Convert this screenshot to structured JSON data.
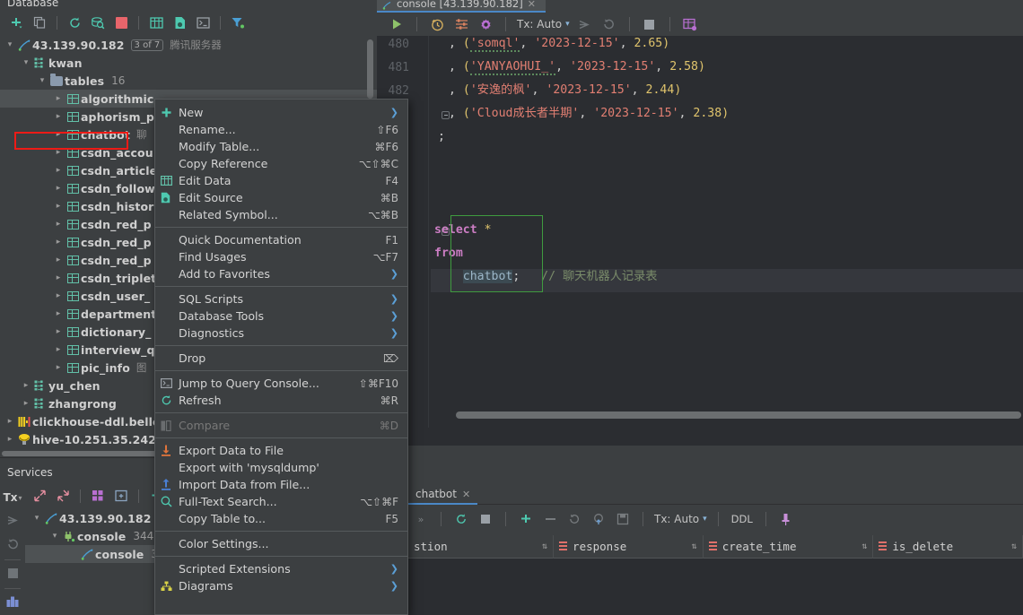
{
  "database_panel": {
    "title": "Database",
    "toolbar": [
      {
        "name": "new-button",
        "icon": "plus-icon"
      },
      {
        "name": "copy-button",
        "icon": "copy-icon"
      },
      {
        "name": "refresh-button",
        "icon": "refresh-icon"
      },
      {
        "name": "search-db-button",
        "icon": "db-search-icon"
      },
      {
        "name": "stop-button",
        "icon": "stop-square-icon"
      },
      {
        "name": "table-view-button",
        "icon": "grid-icon"
      },
      {
        "name": "source-button",
        "icon": "source-file-icon"
      },
      {
        "name": "console-button",
        "icon": "terminal-icon"
      },
      {
        "name": "filter-button",
        "icon": "funnel-icon"
      }
    ],
    "tree": [
      {
        "label": "43.139.90.182",
        "badge": "3 of 7",
        "note": "腾讯服务器",
        "icon": "mysql-icon",
        "state": "open",
        "indent": 0
      },
      {
        "label": "kwan",
        "icon": "schema-icon",
        "state": "open",
        "indent": 1
      },
      {
        "label": "tables",
        "count": "16",
        "icon": "folder-icon",
        "state": "open",
        "indent": 2
      },
      {
        "label": "algorithmic",
        "icon": "table-icon",
        "state": "closed",
        "indent": 3,
        "selected": true
      },
      {
        "label": "aphorism_p",
        "icon": "table-icon",
        "state": "closed",
        "indent": 3
      },
      {
        "label": "chatbot",
        "note": "聊",
        "icon": "table-icon",
        "state": "closed",
        "indent": 3
      },
      {
        "label": "csdn_accou",
        "icon": "table-icon",
        "state": "closed",
        "indent": 3
      },
      {
        "label": "csdn_article",
        "icon": "table-icon",
        "state": "closed",
        "indent": 3
      },
      {
        "label": "csdn_follow",
        "icon": "table-icon",
        "state": "closed",
        "indent": 3
      },
      {
        "label": "csdn_histor",
        "icon": "table-icon",
        "state": "closed",
        "indent": 3
      },
      {
        "label": "csdn_red_p",
        "icon": "table-icon",
        "state": "closed",
        "indent": 3
      },
      {
        "label": "csdn_red_p",
        "icon": "table-icon",
        "state": "closed",
        "indent": 3
      },
      {
        "label": "csdn_red_p",
        "icon": "table-icon",
        "state": "closed",
        "indent": 3
      },
      {
        "label": "csdn_triplet",
        "icon": "table-icon",
        "state": "closed",
        "indent": 3
      },
      {
        "label": "csdn_user_",
        "icon": "table-icon",
        "state": "closed",
        "indent": 3
      },
      {
        "label": "department",
        "icon": "table-icon",
        "state": "closed",
        "indent": 3
      },
      {
        "label": "dictionary_",
        "icon": "table-icon",
        "state": "closed",
        "indent": 3
      },
      {
        "label": "interview_q",
        "icon": "table-icon",
        "state": "closed",
        "indent": 3
      },
      {
        "label": "pic_info",
        "note": "图",
        "icon": "table-icon",
        "state": "closed",
        "indent": 3
      },
      {
        "label": "yu_chen",
        "icon": "schema-icon",
        "state": "closed",
        "indent": 1
      },
      {
        "label": "zhangrong",
        "icon": "schema-icon",
        "state": "closed",
        "indent": 1
      },
      {
        "label": "clickhouse-ddl.belle",
        "icon": "clickhouse-icon",
        "state": "closed",
        "indent": 0
      },
      {
        "label": "hive-10.251.35.242",
        "icon": "hive-icon",
        "state": "closed",
        "indent": 0
      }
    ]
  },
  "context_menu": {
    "groups": [
      [
        {
          "label": "New",
          "icon": "plus-icon",
          "submenu": true
        },
        {
          "label": "Rename...",
          "shortcut": "⇧F6"
        },
        {
          "label": "Modify Table...",
          "shortcut": "⌘F6",
          "highlighted": true
        },
        {
          "label": "Copy Reference",
          "shortcut": "⌥⇧⌘C"
        },
        {
          "label": "Edit Data",
          "shortcut": "F4",
          "icon": "grid-icon"
        },
        {
          "label": "Edit Source",
          "shortcut": "⌘B",
          "icon": "source-file-icon"
        },
        {
          "label": "Related Symbol...",
          "shortcut": "⌥⌘B"
        }
      ],
      [
        {
          "label": "Quick Documentation",
          "shortcut": "F1"
        },
        {
          "label": "Find Usages",
          "shortcut": "⌥F7"
        },
        {
          "label": "Add to Favorites",
          "submenu": true
        }
      ],
      [
        {
          "label": "SQL Scripts",
          "submenu": true
        },
        {
          "label": "Database Tools",
          "submenu": true
        },
        {
          "label": "Diagnostics",
          "submenu": true
        }
      ],
      [
        {
          "label": "Drop",
          "shortcut": "⌦"
        }
      ],
      [
        {
          "label": "Jump to Query Console...",
          "shortcut": "⇧⌘F10",
          "icon": "terminal-icon"
        },
        {
          "label": "Refresh",
          "shortcut": "⌘R",
          "icon": "refresh-icon"
        }
      ],
      [
        {
          "label": "Compare",
          "shortcut": "⌘D",
          "icon": "compare-icon",
          "disabled": true
        }
      ],
      [
        {
          "label": "Export Data to File",
          "icon": "export-icon"
        },
        {
          "label": "Export with 'mysqldump'"
        },
        {
          "label": "Import Data from File...",
          "icon": "import-icon"
        },
        {
          "label": "Full-Text Search...",
          "shortcut": "⌥⇧⌘F",
          "icon": "search-icon"
        },
        {
          "label": "Copy Table to...",
          "shortcut": "F5"
        }
      ],
      [
        {
          "label": "Color Settings..."
        }
      ],
      [
        {
          "label": "Scripted Extensions",
          "submenu": true
        },
        {
          "label": "Diagrams",
          "submenu": true,
          "icon": "diagram-icon"
        }
      ]
    ],
    "highlight_color": "#ee1b16"
  },
  "editor": {
    "tab_title": "console [43.139.90.182]",
    "toolbar": {
      "run_label": "run-icon",
      "tx_label": "Tx: Auto",
      "items": [
        {
          "name": "run-button",
          "icon": "play-icon"
        },
        {
          "name": "history-button",
          "icon": "clock-history-icon"
        },
        {
          "name": "settings-sliders-button",
          "icon": "sliders-icon"
        },
        {
          "name": "gear-button",
          "icon": "gear-icon"
        },
        {
          "name": "commit-button",
          "icon": "commit-arrow-icon"
        },
        {
          "name": "rollback-button",
          "icon": "rollback-icon"
        },
        {
          "name": "stop-button",
          "icon": "stop-square-icon"
        },
        {
          "name": "db-console-button",
          "icon": "db-grid-icon"
        }
      ]
    },
    "line_numbers": [
      "480",
      "481",
      "482"
    ],
    "code_lines": [
      {
        "id": "l480",
        "indent": ", ",
        "paren": "(",
        "str1": "'somql'",
        "sep1": ", ",
        "str2": "'2023-12-15'",
        "sep2": ", ",
        "num": "2.65",
        "close": ")"
      },
      {
        "id": "l481",
        "indent": ", ",
        "paren": "(",
        "str1": "'YANYAOHUI_'",
        "sep1": ", ",
        "str2": "'2023-12-15'",
        "sep2": ", ",
        "num": "2.58",
        "close": ")"
      },
      {
        "id": "l482",
        "indent": ", ",
        "paren": "(",
        "str1": "'安逸的枫'",
        "sep1": ", ",
        "str2": "'2023-12-15'",
        "sep2": ", ",
        "num": "2.44",
        "close": ")"
      },
      {
        "id": "l483",
        "indent": ", ",
        "paren": "(",
        "str1": "'Cloud成长者半期'",
        "sep1": ", ",
        "str2": "'2023-12-15'",
        "sep2": ", ",
        "num": "2.38",
        "close": ")"
      },
      {
        "id": "l484",
        "semicolon": ";"
      }
    ],
    "query": {
      "keyword_select": "select",
      "star": "*",
      "keyword_from": "from",
      "table": "chatbot",
      "semicolon": ";",
      "comment": "// 聊天机器人记录表"
    }
  },
  "services_panel": {
    "title": "Services",
    "sidebar": [
      {
        "name": "tx-button",
        "label": "Tx"
      },
      {
        "name": "commit-button",
        "icon": "commit-arrow-icon"
      },
      {
        "name": "rollback-button",
        "icon": "rollback-icon"
      },
      {
        "name": "stop-button",
        "icon": "stop-square-icon"
      },
      {
        "name": "layout-button",
        "icon": "layout-icon"
      }
    ],
    "toolbar": [
      {
        "name": "expand-button",
        "icon": "expand-icon"
      },
      {
        "name": "collapse-button",
        "icon": "collapse-icon"
      },
      {
        "name": "grid-layout-button",
        "icon": "grid-purple-icon"
      },
      {
        "name": "add-panel-button",
        "icon": "add-panel-icon"
      },
      {
        "name": "add-button",
        "icon": "plus-icon"
      }
    ],
    "tree": [
      {
        "label": "43.139.90.182",
        "icon": "mysql-icon",
        "state": "open",
        "indent": 0
      },
      {
        "label": "console",
        "count": "344",
        "icon": "plug-icon",
        "state": "open",
        "indent": 1
      },
      {
        "label": "console",
        "count": "3",
        "icon": "mysql-icon",
        "state": "none",
        "indent": 2,
        "selected": true
      }
    ]
  },
  "results_panel": {
    "tab_label": "chatbot",
    "toolbar": {
      "tx_label": "Tx: Auto",
      "ddl_label": "DDL",
      "items": [
        {
          "name": "refresh-button",
          "icon": "refresh-icon"
        },
        {
          "name": "stop-button",
          "icon": "stop-square-icon"
        },
        {
          "name": "add-row-button",
          "icon": "plus-icon"
        },
        {
          "name": "delete-row-button",
          "icon": "minus-icon"
        },
        {
          "name": "revert-button",
          "icon": "revert-icon"
        },
        {
          "name": "revert-selected-button",
          "icon": "revert-selected-icon"
        },
        {
          "name": "submit-button",
          "icon": "save-icon"
        },
        {
          "name": "pin-button",
          "icon": "pin-icon"
        }
      ]
    },
    "columns": [
      {
        "label": "stion",
        "truncated": true
      },
      {
        "label": "response"
      },
      {
        "label": "create_time"
      },
      {
        "label": "is_delete"
      }
    ]
  }
}
